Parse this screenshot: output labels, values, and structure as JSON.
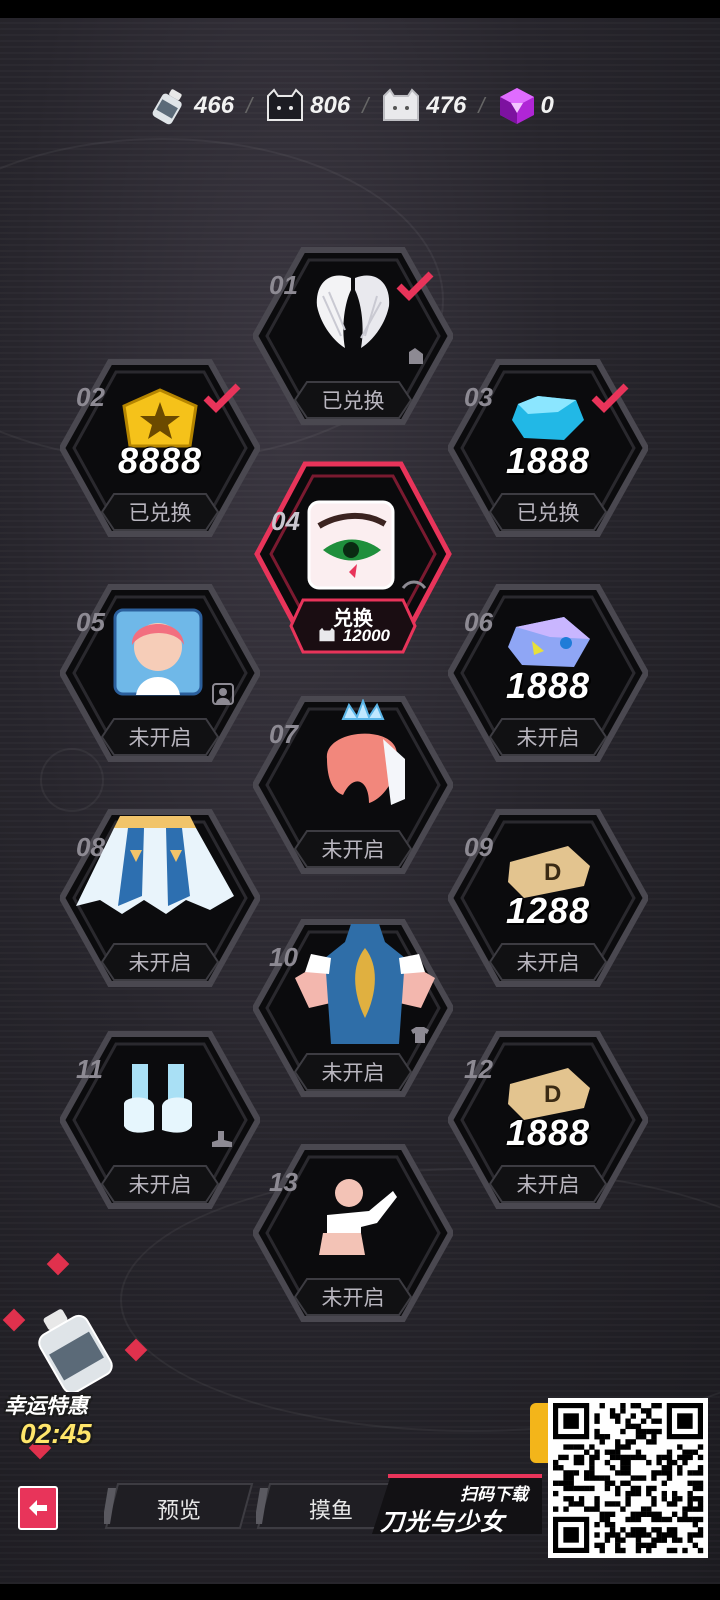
{
  "currencies": [
    {
      "icon": "bottle-icon",
      "value": "466"
    },
    {
      "icon": "black-cat-token-icon",
      "value": "806"
    },
    {
      "icon": "white-cat-token-icon",
      "value": "476"
    },
    {
      "icon": "purple-cube-icon",
      "value": "0"
    }
  ],
  "tiles": [
    {
      "num": "01",
      "item": "angel-wings",
      "button": "已兑换",
      "claimed": true,
      "amount": ""
    },
    {
      "num": "02",
      "item": "gold-star-badge",
      "button": "已兑换",
      "claimed": true,
      "amount": "8888"
    },
    {
      "num": "03",
      "item": "blue-gem",
      "button": "已兑换",
      "claimed": true,
      "amount": "1888"
    },
    {
      "num": "04",
      "item": "eye-makeup",
      "button": "兑换",
      "cost": "12000",
      "active": true
    },
    {
      "num": "05",
      "item": "avatar-portrait",
      "button": "未开启",
      "amount": ""
    },
    {
      "num": "06",
      "item": "crystal-ticket",
      "button": "未开启",
      "amount": "1888"
    },
    {
      "num": "07",
      "item": "pink-hair-crown",
      "button": "未开启",
      "amount": ""
    },
    {
      "num": "08",
      "item": "blue-skirt",
      "button": "未开启",
      "amount": ""
    },
    {
      "num": "09",
      "item": "gold-d-ticket",
      "button": "未开启",
      "amount": "1288"
    },
    {
      "num": "10",
      "item": "blue-dress-top",
      "button": "未开启",
      "amount": ""
    },
    {
      "num": "11",
      "item": "blue-shoes",
      "button": "未开启",
      "amount": ""
    },
    {
      "num": "12",
      "item": "gold-d-ticket",
      "button": "未开启",
      "amount": "1888"
    },
    {
      "num": "13",
      "item": "pose-action",
      "button": "未开启",
      "amount": ""
    }
  ],
  "promo": {
    "title": "幸运特惠",
    "timer": "02:45"
  },
  "nav": {
    "preview": "预览",
    "slack": "摸鱼"
  },
  "download": {
    "scan": "扫码下载",
    "game": "刀光与少女"
  },
  "colors": {
    "accent": "#e8345a",
    "tile_bg": "#0a0a0c",
    "frame": "#4a4850"
  }
}
